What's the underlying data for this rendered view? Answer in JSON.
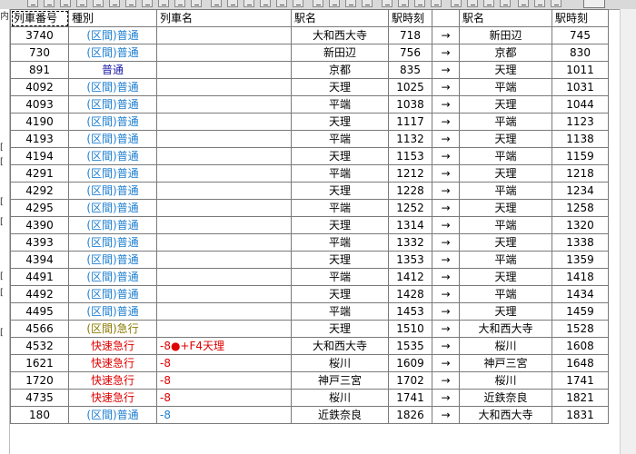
{
  "header": {
    "col_number": "列車番号",
    "col_type": "種別",
    "col_name": "列車名",
    "col_station1": "駅名",
    "col_time1": "駅時刻",
    "col_station2": "駅名",
    "col_time2": "駅時刻"
  },
  "left_gutter": [
    "内",
    "[",
    "[",
    "[",
    "[",
    "[",
    "[",
    "["
  ],
  "rows": [
    {
      "number": "3740",
      "type": "(区間)普通",
      "type_class": "c-local",
      "name": "",
      "name_class": "",
      "from": "大和西大寺",
      "dep": "718",
      "arrow": "→",
      "to": "新田辺",
      "arr": "745"
    },
    {
      "number": "730",
      "type": "(区間)普通",
      "type_class": "c-local",
      "name": "",
      "name_class": "",
      "from": "新田辺",
      "dep": "756",
      "arrow": "→",
      "to": "京都",
      "arr": "830"
    },
    {
      "number": "891",
      "type": "普通",
      "type_class": "c-plain",
      "name": "",
      "name_class": "",
      "from": "京都",
      "dep": "835",
      "arrow": "→",
      "to": "天理",
      "arr": "1011"
    },
    {
      "number": "4092",
      "type": "(区間)普通",
      "type_class": "c-local",
      "name": "",
      "name_class": "",
      "from": "天理",
      "dep": "1025",
      "arrow": "→",
      "to": "平端",
      "arr": "1031"
    },
    {
      "number": "4093",
      "type": "(区間)普通",
      "type_class": "c-local",
      "name": "",
      "name_class": "",
      "from": "平端",
      "dep": "1038",
      "arrow": "→",
      "to": "天理",
      "arr": "1044"
    },
    {
      "number": "4190",
      "type": "(区間)普通",
      "type_class": "c-local",
      "name": "",
      "name_class": "",
      "from": "天理",
      "dep": "1117",
      "arrow": "→",
      "to": "平端",
      "arr": "1123"
    },
    {
      "number": "4193",
      "type": "(区間)普通",
      "type_class": "c-local",
      "name": "",
      "name_class": "",
      "from": "平端",
      "dep": "1132",
      "arrow": "→",
      "to": "天理",
      "arr": "1138"
    },
    {
      "number": "4194",
      "type": "(区間)普通",
      "type_class": "c-local",
      "name": "",
      "name_class": "",
      "from": "天理",
      "dep": "1153",
      "arrow": "→",
      "to": "平端",
      "arr": "1159"
    },
    {
      "number": "4291",
      "type": "(区間)普通",
      "type_class": "c-local",
      "name": "",
      "name_class": "",
      "from": "平端",
      "dep": "1212",
      "arrow": "→",
      "to": "天理",
      "arr": "1218"
    },
    {
      "number": "4292",
      "type": "(区間)普通",
      "type_class": "c-local",
      "name": "",
      "name_class": "",
      "from": "天理",
      "dep": "1228",
      "arrow": "→",
      "to": "平端",
      "arr": "1234"
    },
    {
      "number": "4295",
      "type": "(区間)普通",
      "type_class": "c-local",
      "name": "",
      "name_class": "",
      "from": "平端",
      "dep": "1252",
      "arrow": "→",
      "to": "天理",
      "arr": "1258"
    },
    {
      "number": "4390",
      "type": "(区間)普通",
      "type_class": "c-local",
      "name": "",
      "name_class": "",
      "from": "天理",
      "dep": "1314",
      "arrow": "→",
      "to": "平端",
      "arr": "1320"
    },
    {
      "number": "4393",
      "type": "(区間)普通",
      "type_class": "c-local",
      "name": "",
      "name_class": "",
      "from": "平端",
      "dep": "1332",
      "arrow": "→",
      "to": "天理",
      "arr": "1338"
    },
    {
      "number": "4394",
      "type": "(区間)普通",
      "type_class": "c-local",
      "name": "",
      "name_class": "",
      "from": "天理",
      "dep": "1353",
      "arrow": "→",
      "to": "平端",
      "arr": "1359"
    },
    {
      "number": "4491",
      "type": "(区間)普通",
      "type_class": "c-local",
      "name": "",
      "name_class": "",
      "from": "平端",
      "dep": "1412",
      "arrow": "→",
      "to": "天理",
      "arr": "1418"
    },
    {
      "number": "4492",
      "type": "(区間)普通",
      "type_class": "c-local",
      "name": "",
      "name_class": "",
      "from": "天理",
      "dep": "1428",
      "arrow": "→",
      "to": "平端",
      "arr": "1434"
    },
    {
      "number": "4495",
      "type": "(区間)普通",
      "type_class": "c-local",
      "name": "",
      "name_class": "",
      "from": "平端",
      "dep": "1453",
      "arrow": "→",
      "to": "天理",
      "arr": "1459"
    },
    {
      "number": "4566",
      "type": "(区間)急行",
      "type_class": "c-exp",
      "name": "",
      "name_class": "",
      "from": "天理",
      "dep": "1510",
      "arrow": "→",
      "to": "大和西大寺",
      "arr": "1528"
    },
    {
      "number": "4532",
      "type": "快速急行",
      "type_class": "c-rapid",
      "name": "-8●+F4天理",
      "name_class": "c-red",
      "from": "大和西大寺",
      "dep": "1535",
      "arrow": "→",
      "to": "桜川",
      "arr": "1608"
    },
    {
      "number": "1621",
      "type": "快速急行",
      "type_class": "c-rapid",
      "name": "-8",
      "name_class": "c-red",
      "from": "桜川",
      "dep": "1609",
      "arrow": "→",
      "to": "神戸三宮",
      "arr": "1648"
    },
    {
      "number": "1720",
      "type": "快速急行",
      "type_class": "c-rapid",
      "name": "-8",
      "name_class": "c-red",
      "from": "神戸三宮",
      "dep": "1702",
      "arrow": "→",
      "to": "桜川",
      "arr": "1741"
    },
    {
      "number": "4735",
      "type": "快速急行",
      "type_class": "c-rapid",
      "name": "-8",
      "name_class": "c-red",
      "from": "桜川",
      "dep": "1741",
      "arrow": "→",
      "to": "近鉄奈良",
      "arr": "1821"
    },
    {
      "number": "180",
      "type": "(区間)普通",
      "type_class": "c-local",
      "name": "-8",
      "name_class": "c-blue",
      "from": "近鉄奈良",
      "dep": "1826",
      "arrow": "→",
      "to": "大和西大寺",
      "arr": "1831"
    }
  ]
}
